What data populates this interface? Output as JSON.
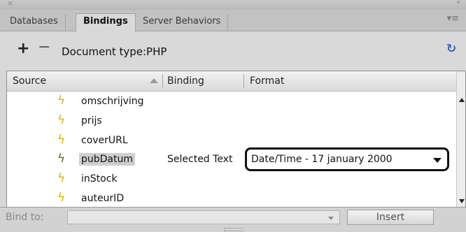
{
  "window": {
    "close_glyph": "×",
    "collapse_glyph": "»"
  },
  "tabs": [
    {
      "label": "Databases",
      "active": false
    },
    {
      "label": "Bindings",
      "active": true
    },
    {
      "label": "Server Behaviors",
      "active": false
    }
  ],
  "panel_menu_icon": "panel-menu-icon",
  "toolbar": {
    "add_glyph": "+",
    "remove_glyph": "−",
    "doctype_text": "Document type:PHP",
    "refresh_glyph": "↻"
  },
  "table": {
    "columns": [
      "Source",
      "Binding",
      "Format"
    ],
    "rows": [
      {
        "source": "omschrijving",
        "binding": "",
        "format": "",
        "selected": false
      },
      {
        "source": "prijs",
        "binding": "",
        "format": "",
        "selected": false
      },
      {
        "source": "coverURL",
        "binding": "",
        "format": "",
        "selected": false
      },
      {
        "source": "pubDatum",
        "binding": "Selected Text",
        "format": "Date/Time - 17 january 2000",
        "selected": true
      },
      {
        "source": "inStock",
        "binding": "",
        "format": "",
        "selected": false
      },
      {
        "source": "auteurID",
        "binding": "",
        "format": "",
        "selected": false
      }
    ]
  },
  "footer": {
    "bind_to_label": "Bind to:",
    "bind_to_value": "",
    "insert_label": "Insert"
  },
  "colors": {
    "bolt": "#d7b400",
    "bolt_selected": "#6f6215",
    "selection": "#cfcfcf",
    "refresh": "#3a62b8"
  }
}
